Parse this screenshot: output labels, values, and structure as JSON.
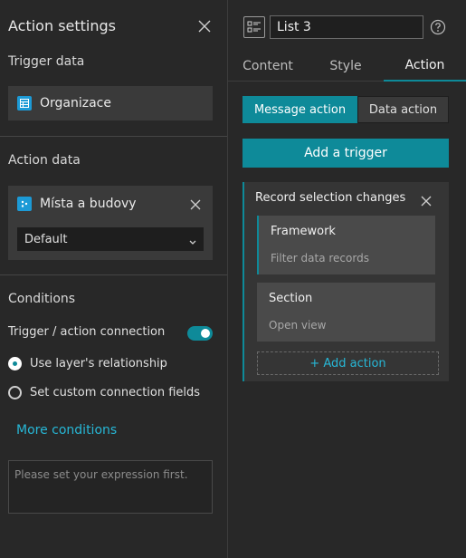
{
  "left_panel": {
    "title": "Action settings",
    "trigger_data": {
      "label": "Trigger data",
      "source": "Organizace"
    },
    "action_data": {
      "label": "Action data",
      "source": "Místa a budovy",
      "view_select": "Default"
    },
    "conditions": {
      "label": "Conditions",
      "toggle_label": "Trigger / action connection",
      "toggle_on": true,
      "radio_options": [
        {
          "label": "Use layer's relationship",
          "checked": true
        },
        {
          "label": "Set custom connection fields",
          "checked": false
        }
      ],
      "more_link": "More conditions",
      "expression_placeholder": "Please set your expression first."
    }
  },
  "right_panel": {
    "widget_name": "List 3",
    "tabs": [
      "Content",
      "Style",
      "Action"
    ],
    "active_tab": "Action",
    "segments": [
      "Message action",
      "Data action"
    ],
    "active_segment": "Message action",
    "add_trigger": "Add a trigger",
    "trigger_card": {
      "title": "Record selection changes",
      "actions": [
        {
          "title": "Framework",
          "desc": "Filter data records",
          "selected": true
        },
        {
          "title": "Section",
          "desc": "Open view",
          "selected": false
        }
      ],
      "add_action": "+ Add action"
    }
  },
  "colors": {
    "accent": "#0e8a99",
    "link": "#27b7d6",
    "background": "#282828",
    "datasource_icon": "#1c9ad6"
  }
}
